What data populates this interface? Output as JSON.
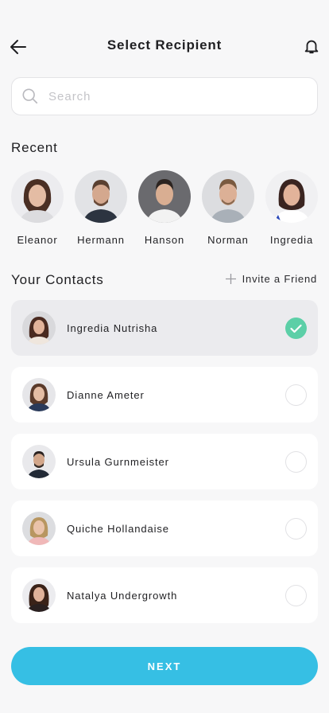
{
  "header": {
    "title": "Select Recipient",
    "back_icon": "arrow-left-icon",
    "bell_icon": "bell-icon"
  },
  "search": {
    "placeholder": "Search",
    "value": "",
    "icon": "search-icon"
  },
  "recent": {
    "title": "Recent",
    "people": [
      {
        "name": "Eleanor"
      },
      {
        "name": "Hermann"
      },
      {
        "name": "Hanson"
      },
      {
        "name": "Norman"
      },
      {
        "name": "Ingredia"
      }
    ]
  },
  "contacts": {
    "title": "Your Contacts",
    "invite_label": "Invite a Friend",
    "items": [
      {
        "name": "Ingredia Nutrisha",
        "selected": true
      },
      {
        "name": "Dianne Ameter",
        "selected": false
      },
      {
        "name": "Ursula Gurnmeister",
        "selected": false
      },
      {
        "name": "Quiche Hollandaise",
        "selected": false
      },
      {
        "name": "Natalya Undergrowth",
        "selected": false
      }
    ]
  },
  "footer": {
    "next_label": "NEXT"
  },
  "colors": {
    "accent": "#36bfe4",
    "check": "#5ccfa7",
    "background": "#f7f7f8",
    "selected_row": "#ebebee"
  }
}
